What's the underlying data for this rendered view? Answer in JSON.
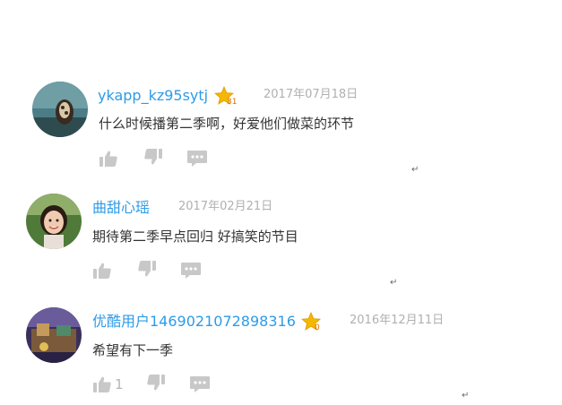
{
  "colors": {
    "username": "#2d9be8",
    "date": "#b0b0b0",
    "text": "#333333",
    "icon": "#c8c8c8",
    "badge": "#f5b800"
  },
  "return_mark": "↵",
  "comments": [
    {
      "username": "ykapp_kz95sytj",
      "level": "31",
      "date": "2017年07月18日",
      "text": "什么时候播第二季啊，好爱他们做菜的环节",
      "like_count": "",
      "icons": {
        "like": "thumbs-up-icon",
        "dislike": "thumbs-down-icon",
        "reply": "comment-icon"
      }
    },
    {
      "username": "曲甜心瑶",
      "level": "",
      "date": "2017年02月21日",
      "text": "期待第二季早点回归 好搞笑的节目",
      "like_count": "",
      "icons": {
        "like": "thumbs-up-icon",
        "dislike": "thumbs-down-icon",
        "reply": "comment-icon"
      }
    },
    {
      "username": "优酷用户1469021072898316",
      "level": "0",
      "date": "2016年12月11日",
      "text": "希望有下一季",
      "like_count": "1",
      "icons": {
        "like": "thumbs-up-icon",
        "dislike": "thumbs-down-icon",
        "reply": "comment-icon"
      }
    }
  ]
}
